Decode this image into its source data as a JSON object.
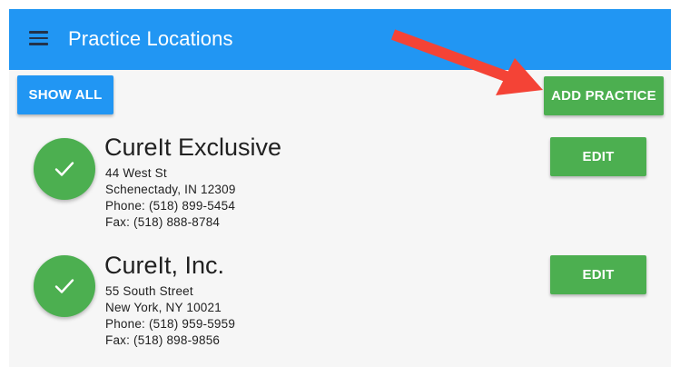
{
  "appbar": {
    "title": "Practice Locations",
    "menu_icon": "hamburger-menu-icon",
    "background": "#2196f3"
  },
  "toolbar": {
    "show_all_label": "SHOW ALL",
    "add_practice_label": "ADD PRACTICE"
  },
  "practices": [
    {
      "status_icon": "check-icon",
      "name": "CureIt Exclusive",
      "street": "44 West St",
      "city_line": "Schenectady, IN 12309",
      "phone": "Phone: (518) 899-5454",
      "fax": "Fax: (518) 888-8784",
      "edit_label": "EDIT"
    },
    {
      "status_icon": "check-icon",
      "name": "CureIt, Inc.",
      "street": "55 South Street",
      "city_line": "New York, NY 10021",
      "phone": "Phone: (518) 959-5959",
      "fax": "Fax: (518) 898-9856",
      "edit_label": "EDIT"
    }
  ],
  "annotation": {
    "arrow_color": "#f44336",
    "arrow_icon": "red-arrow-annotation"
  },
  "colors": {
    "primary": "#2196f3",
    "success": "#4caf50",
    "background": "#f6f6f6"
  }
}
